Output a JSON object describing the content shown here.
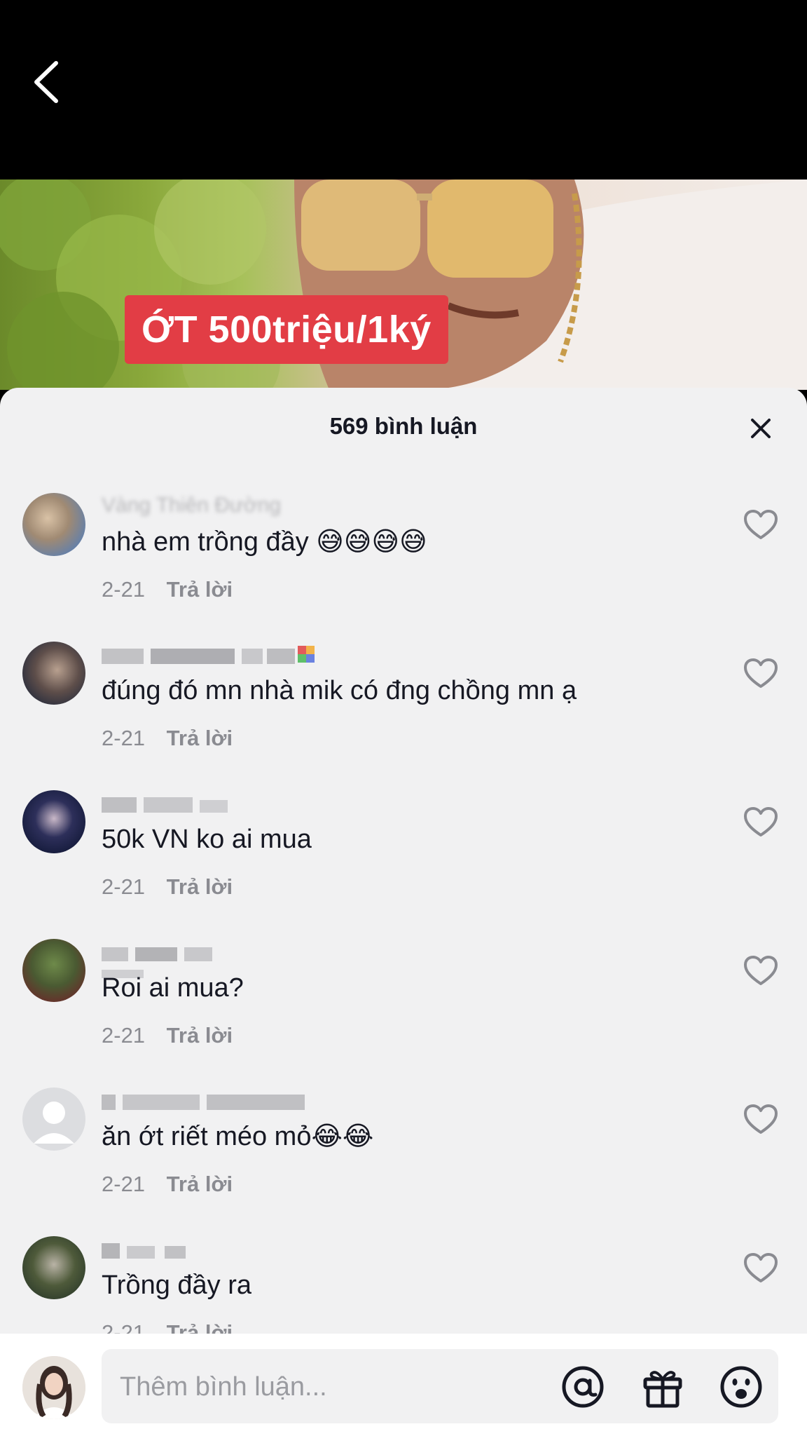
{
  "video": {
    "caption": "ỚT 500triệu/1ký"
  },
  "sheet": {
    "title": "569 bình luận"
  },
  "comments": [
    {
      "user": "Vàng Thiên Đường",
      "text": "nhà em trồng đầy 😅😅😅😅",
      "date": "2-21",
      "reply": "Trả lời"
    },
    {
      "user": "",
      "text": "đúng đó mn nhà mik có đng chồng mn ạ",
      "date": "2-21",
      "reply": "Trả lời"
    },
    {
      "user": "",
      "text": "50k VN ko ai mua",
      "date": "2-21",
      "reply": "Trả lời"
    },
    {
      "user": "",
      "text": "Roi ai mua?",
      "date": "2-21",
      "reply": "Trả lời"
    },
    {
      "user": "",
      "text": "ăn ớt riết méo mỏ😂😂",
      "date": "2-21",
      "reply": "Trả lời"
    },
    {
      "user": "",
      "text": "Trồng đầy ra",
      "date": "2-21",
      "reply": "Trả lời"
    }
  ],
  "input": {
    "placeholder": "Thêm bình luận..."
  },
  "icons": {
    "back": "back-arrow-icon",
    "close": "close-icon",
    "like": "heart-outline-icon",
    "mention": "at-sign-icon",
    "gift": "gift-icon",
    "emoji": "emoji-icon"
  },
  "colors": {
    "sheet_bg": "#f1f1f2",
    "caption_bg": "#e23d45",
    "text_primary": "#161823",
    "text_secondary": "#8a8b91"
  }
}
